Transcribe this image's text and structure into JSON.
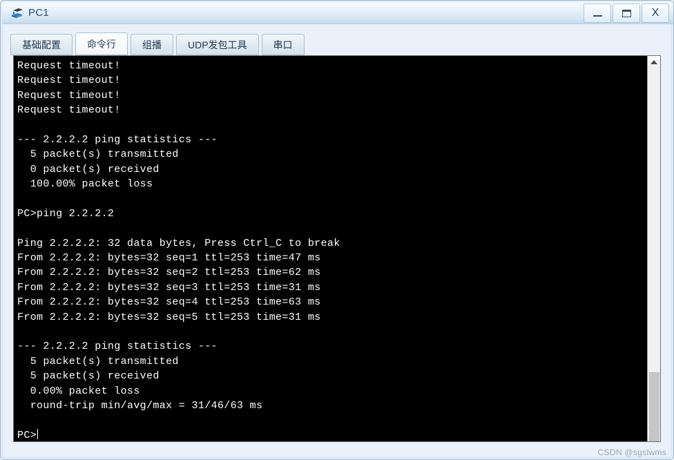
{
  "window": {
    "title": "PC1",
    "icon": "pc-device-icon",
    "controls": {
      "minimize_label": "–",
      "maximize_label": "□",
      "close_label": "X"
    }
  },
  "tabs": [
    {
      "label": "基础配置",
      "name": "tab-basic-config",
      "active": false
    },
    {
      "label": "命令行",
      "name": "tab-command-line",
      "active": true
    },
    {
      "label": "组播",
      "name": "tab-multicast",
      "active": false
    },
    {
      "label": "UDP发包工具",
      "name": "tab-udp-tool",
      "active": false
    },
    {
      "label": "串口",
      "name": "tab-serial-port",
      "active": false
    }
  ],
  "terminal": {
    "prompt": "PC>",
    "lines": [
      "Request timeout!",
      "Request timeout!",
      "Request timeout!",
      "Request timeout!",
      "",
      "--- 2.2.2.2 ping statistics ---",
      "  5 packet(s) transmitted",
      "  0 packet(s) received",
      "  100.00% packet loss",
      "",
      "PC>ping 2.2.2.2",
      "",
      "Ping 2.2.2.2: 32 data bytes, Press Ctrl_C to break",
      "From 2.2.2.2: bytes=32 seq=1 ttl=253 time=47 ms",
      "From 2.2.2.2: bytes=32 seq=2 ttl=253 time=62 ms",
      "From 2.2.2.2: bytes=32 seq=3 ttl=253 time=31 ms",
      "From 2.2.2.2: bytes=32 seq=4 ttl=253 time=63 ms",
      "From 2.2.2.2: bytes=32 seq=5 ttl=253 time=31 ms",
      "",
      "--- 2.2.2.2 ping statistics ---",
      "  5 packet(s) transmitted",
      "  5 packet(s) received",
      "  0.00% packet loss",
      "  round-trip min/avg/max = 31/46/63 ms",
      ""
    ]
  },
  "scrollbar": {
    "up_icon": "chevron-up-icon",
    "down_icon": "chevron-down-icon"
  },
  "watermark": {
    "text": "CSDN @sgslwms"
  },
  "colors": {
    "terminal_bg": "#000000",
    "terminal_fg": "#ffffff",
    "title_text": "#23527c",
    "frame": "#dce9f7"
  }
}
